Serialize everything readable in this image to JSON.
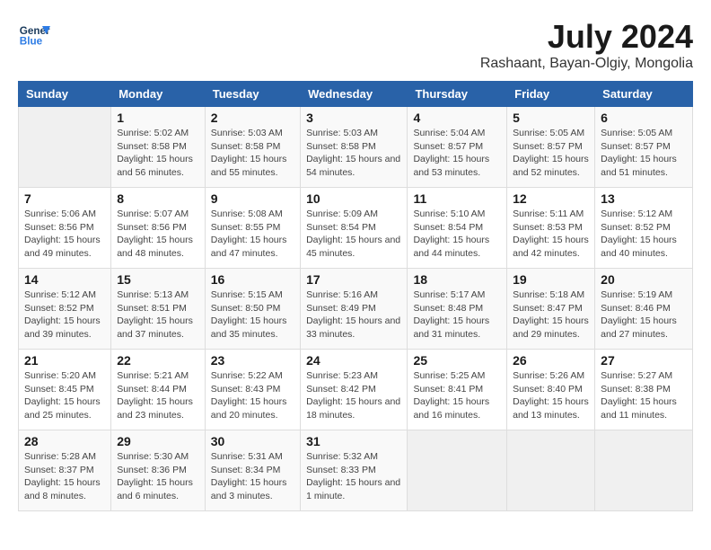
{
  "logo": {
    "line1": "General",
    "line2": "Blue"
  },
  "title": {
    "month_year": "July 2024",
    "location": "Rashaant, Bayan-Olgiy, Mongolia"
  },
  "columns": [
    "Sunday",
    "Monday",
    "Tuesday",
    "Wednesday",
    "Thursday",
    "Friday",
    "Saturday"
  ],
  "weeks": [
    [
      {
        "day": "",
        "sunrise": "",
        "sunset": "",
        "daylight": ""
      },
      {
        "day": "1",
        "sunrise": "Sunrise: 5:02 AM",
        "sunset": "Sunset: 8:58 PM",
        "daylight": "Daylight: 15 hours and 56 minutes."
      },
      {
        "day": "2",
        "sunrise": "Sunrise: 5:03 AM",
        "sunset": "Sunset: 8:58 PM",
        "daylight": "Daylight: 15 hours and 55 minutes."
      },
      {
        "day": "3",
        "sunrise": "Sunrise: 5:03 AM",
        "sunset": "Sunset: 8:58 PM",
        "daylight": "Daylight: 15 hours and 54 minutes."
      },
      {
        "day": "4",
        "sunrise": "Sunrise: 5:04 AM",
        "sunset": "Sunset: 8:57 PM",
        "daylight": "Daylight: 15 hours and 53 minutes."
      },
      {
        "day": "5",
        "sunrise": "Sunrise: 5:05 AM",
        "sunset": "Sunset: 8:57 PM",
        "daylight": "Daylight: 15 hours and 52 minutes."
      },
      {
        "day": "6",
        "sunrise": "Sunrise: 5:05 AM",
        "sunset": "Sunset: 8:57 PM",
        "daylight": "Daylight: 15 hours and 51 minutes."
      }
    ],
    [
      {
        "day": "7",
        "sunrise": "Sunrise: 5:06 AM",
        "sunset": "Sunset: 8:56 PM",
        "daylight": "Daylight: 15 hours and 49 minutes."
      },
      {
        "day": "8",
        "sunrise": "Sunrise: 5:07 AM",
        "sunset": "Sunset: 8:56 PM",
        "daylight": "Daylight: 15 hours and 48 minutes."
      },
      {
        "day": "9",
        "sunrise": "Sunrise: 5:08 AM",
        "sunset": "Sunset: 8:55 PM",
        "daylight": "Daylight: 15 hours and 47 minutes."
      },
      {
        "day": "10",
        "sunrise": "Sunrise: 5:09 AM",
        "sunset": "Sunset: 8:54 PM",
        "daylight": "Daylight: 15 hours and 45 minutes."
      },
      {
        "day": "11",
        "sunrise": "Sunrise: 5:10 AM",
        "sunset": "Sunset: 8:54 PM",
        "daylight": "Daylight: 15 hours and 44 minutes."
      },
      {
        "day": "12",
        "sunrise": "Sunrise: 5:11 AM",
        "sunset": "Sunset: 8:53 PM",
        "daylight": "Daylight: 15 hours and 42 minutes."
      },
      {
        "day": "13",
        "sunrise": "Sunrise: 5:12 AM",
        "sunset": "Sunset: 8:52 PM",
        "daylight": "Daylight: 15 hours and 40 minutes."
      }
    ],
    [
      {
        "day": "14",
        "sunrise": "Sunrise: 5:12 AM",
        "sunset": "Sunset: 8:52 PM",
        "daylight": "Daylight: 15 hours and 39 minutes."
      },
      {
        "day": "15",
        "sunrise": "Sunrise: 5:13 AM",
        "sunset": "Sunset: 8:51 PM",
        "daylight": "Daylight: 15 hours and 37 minutes."
      },
      {
        "day": "16",
        "sunrise": "Sunrise: 5:15 AM",
        "sunset": "Sunset: 8:50 PM",
        "daylight": "Daylight: 15 hours and 35 minutes."
      },
      {
        "day": "17",
        "sunrise": "Sunrise: 5:16 AM",
        "sunset": "Sunset: 8:49 PM",
        "daylight": "Daylight: 15 hours and 33 minutes."
      },
      {
        "day": "18",
        "sunrise": "Sunrise: 5:17 AM",
        "sunset": "Sunset: 8:48 PM",
        "daylight": "Daylight: 15 hours and 31 minutes."
      },
      {
        "day": "19",
        "sunrise": "Sunrise: 5:18 AM",
        "sunset": "Sunset: 8:47 PM",
        "daylight": "Daylight: 15 hours and 29 minutes."
      },
      {
        "day": "20",
        "sunrise": "Sunrise: 5:19 AM",
        "sunset": "Sunset: 8:46 PM",
        "daylight": "Daylight: 15 hours and 27 minutes."
      }
    ],
    [
      {
        "day": "21",
        "sunrise": "Sunrise: 5:20 AM",
        "sunset": "Sunset: 8:45 PM",
        "daylight": "Daylight: 15 hours and 25 minutes."
      },
      {
        "day": "22",
        "sunrise": "Sunrise: 5:21 AM",
        "sunset": "Sunset: 8:44 PM",
        "daylight": "Daylight: 15 hours and 23 minutes."
      },
      {
        "day": "23",
        "sunrise": "Sunrise: 5:22 AM",
        "sunset": "Sunset: 8:43 PM",
        "daylight": "Daylight: 15 hours and 20 minutes."
      },
      {
        "day": "24",
        "sunrise": "Sunrise: 5:23 AM",
        "sunset": "Sunset: 8:42 PM",
        "daylight": "Daylight: 15 hours and 18 minutes."
      },
      {
        "day": "25",
        "sunrise": "Sunrise: 5:25 AM",
        "sunset": "Sunset: 8:41 PM",
        "daylight": "Daylight: 15 hours and 16 minutes."
      },
      {
        "day": "26",
        "sunrise": "Sunrise: 5:26 AM",
        "sunset": "Sunset: 8:40 PM",
        "daylight": "Daylight: 15 hours and 13 minutes."
      },
      {
        "day": "27",
        "sunrise": "Sunrise: 5:27 AM",
        "sunset": "Sunset: 8:38 PM",
        "daylight": "Daylight: 15 hours and 11 minutes."
      }
    ],
    [
      {
        "day": "28",
        "sunrise": "Sunrise: 5:28 AM",
        "sunset": "Sunset: 8:37 PM",
        "daylight": "Daylight: 15 hours and 8 minutes."
      },
      {
        "day": "29",
        "sunrise": "Sunrise: 5:30 AM",
        "sunset": "Sunset: 8:36 PM",
        "daylight": "Daylight: 15 hours and 6 minutes."
      },
      {
        "day": "30",
        "sunrise": "Sunrise: 5:31 AM",
        "sunset": "Sunset: 8:34 PM",
        "daylight": "Daylight: 15 hours and 3 minutes."
      },
      {
        "day": "31",
        "sunrise": "Sunrise: 5:32 AM",
        "sunset": "Sunset: 8:33 PM",
        "daylight": "Daylight: 15 hours and 1 minute."
      },
      {
        "day": "",
        "sunrise": "",
        "sunset": "",
        "daylight": ""
      },
      {
        "day": "",
        "sunrise": "",
        "sunset": "",
        "daylight": ""
      },
      {
        "day": "",
        "sunrise": "",
        "sunset": "",
        "daylight": ""
      }
    ]
  ]
}
